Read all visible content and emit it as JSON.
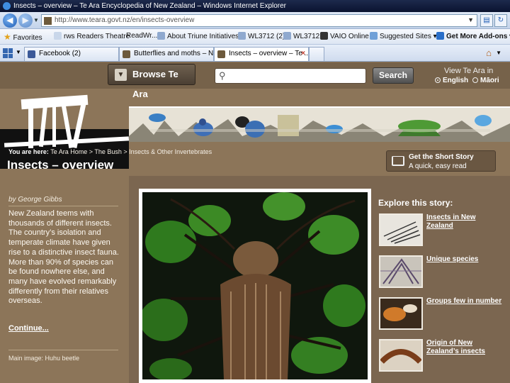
{
  "browser": {
    "window_title": "Insects – overview – Te Ara Encyclopedia of New Zealand – Windows Internet Explorer",
    "url": "http://www.teara.govt.nz/en/insects-overview",
    "favorites_label": "Favorites",
    "favorites": [
      "rws Readers Theatre",
      "ReadWr...",
      "About Triune Initiatives",
      "WL3712 (2)",
      "WL3712",
      "VAIO Online",
      "Suggested Sites ▾",
      "Get More Add-ons ▾"
    ],
    "tabs": [
      {
        "label": "Facebook (2)"
      },
      {
        "label": "Butterflies and moths – Ne..."
      },
      {
        "label": "Insects – overview – Te ..."
      }
    ]
  },
  "header": {
    "browse_label": "Browse Te Ara",
    "search_placeholder": "",
    "search_button": "Search",
    "lang_title": "View Te Ara in",
    "lang_english": "English",
    "lang_maori": "Māori"
  },
  "breadcrumb": {
    "prefix": "You are here:",
    "path": "Te Ara Home > The Bush > Insects & Other Invertebrates"
  },
  "page_title": "Insects – overview",
  "short_story": {
    "title": "Get the Short Story",
    "subtitle": "A quick, easy read"
  },
  "sidebar": {
    "author": "by George Gibbs",
    "intro": "New Zealand teems with thousands of different insects. The country’s isolation and temperate climate have given rise to a distinctive insect fauna. More than 90% of species can be found nowhere else, and many have evolved remarkably differently from their relatives overseas.",
    "continue": "Continue...",
    "main_image": "Main image: Huhu beetle"
  },
  "explore": {
    "title": "Explore this story:",
    "items": [
      {
        "label": "Insects in New Zealand"
      },
      {
        "label": "Unique species"
      },
      {
        "label": "Groups few in number"
      },
      {
        "label": "Origin of New Zealand’s insects"
      }
    ]
  },
  "colors": {
    "page_bg": "#8c7559",
    "top_band": "#76624a",
    "content_bg": "#7b6650"
  }
}
